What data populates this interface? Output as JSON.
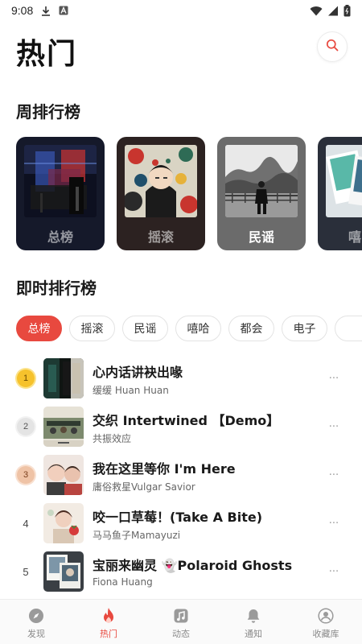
{
  "status_bar": {
    "time": "9:08",
    "icons": [
      "download-icon",
      "font-a-icon",
      "wifi-icon",
      "signal-icon",
      "battery-icon"
    ]
  },
  "header": {
    "title": "热门",
    "search_icon": "search-icon"
  },
  "weekly": {
    "title": "周排行榜",
    "cards": [
      {
        "label": "总榜"
      },
      {
        "label": "摇滚"
      },
      {
        "label": "民谣"
      },
      {
        "label": "嘻"
      }
    ]
  },
  "realtime": {
    "title": "即时排行榜",
    "chips": [
      {
        "label": "总榜",
        "active": true
      },
      {
        "label": "摇滚"
      },
      {
        "label": "民谣"
      },
      {
        "label": "嘻哈"
      },
      {
        "label": "都会"
      },
      {
        "label": "电子"
      },
      {
        "label": ""
      }
    ],
    "tracks": [
      {
        "rank": "1",
        "title": "心内话讲袂出喙",
        "artist": "缓缓 Huan Huan"
      },
      {
        "rank": "2",
        "title": "交织 Intertwined 【Demo】",
        "artist": "共振效应"
      },
      {
        "rank": "3",
        "title": "我在这里等你 I'm Here",
        "artist": "庸俗救星Vulgar Savior"
      },
      {
        "rank": "4",
        "title": "咬一口草莓！(Take A Bite)",
        "artist": "马马鱼子Mamayuzi"
      },
      {
        "rank": "5",
        "title": "宝丽来幽灵 👻Polaroid Ghosts",
        "artist": "Fiona Huang"
      }
    ],
    "more_label": "···"
  },
  "bottom_nav": [
    {
      "label": "发现",
      "icon": "compass-icon"
    },
    {
      "label": "热门",
      "icon": "fire-icon",
      "active": true
    },
    {
      "label": "动态",
      "icon": "music-note-icon"
    },
    {
      "label": "通知",
      "icon": "bell-icon"
    },
    {
      "label": "收藏库",
      "icon": "user-circle-icon"
    }
  ],
  "colors": {
    "accent": "#e8493f",
    "gold": "#f6c22c",
    "silver": "#e4e4e4",
    "bronze": "#efc3a6"
  }
}
